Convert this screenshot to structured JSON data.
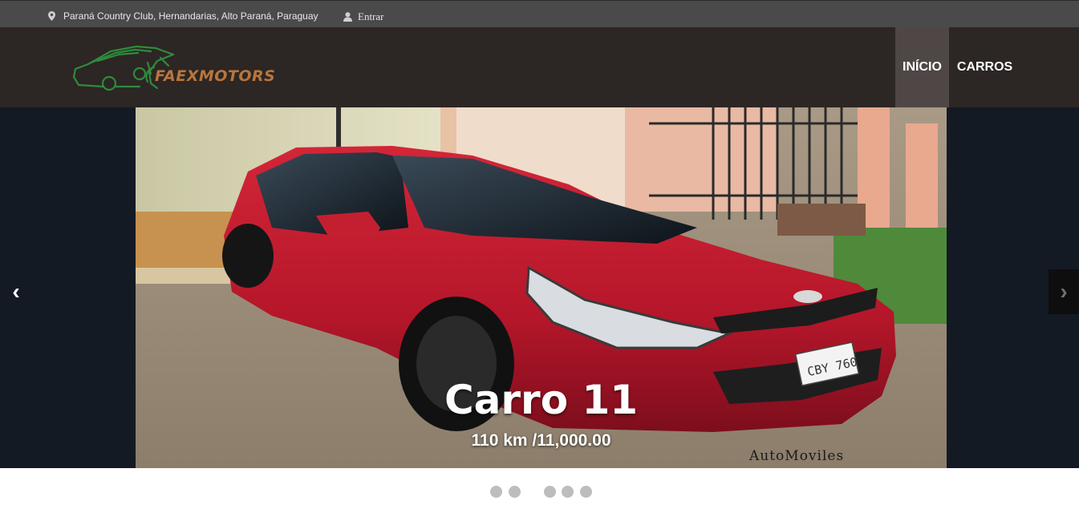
{
  "topbar": {
    "location": "Paraná Country Club, Hernandarias, Alto Paraná, Paraguay",
    "login_label": "Entrar",
    "location_icon": "map-marker-icon",
    "login_icon": "user-icon"
  },
  "brand": {
    "name": "FAEXMOTORS",
    "logo_icon": "car-outline-icon",
    "logo_color": "#2e8b3c",
    "text_color": "#b9763c"
  },
  "nav": {
    "items": [
      {
        "label": "INÍCIO",
        "active": true
      },
      {
        "label": "CARROS",
        "active": false
      }
    ]
  },
  "slider": {
    "title": "Carro 11",
    "subtitle": "110 km /11,000.00",
    "watermark": "AutoMoviles",
    "plate": "CBY 760",
    "prev_symbol": "‹",
    "next_symbol": "›",
    "indicator_count": 5
  },
  "colors": {
    "topbar_bg": "#4a4a4a",
    "navbar_bg": "#2c2624",
    "nav_active_bg": "#4f4745",
    "slider_bg": "#141a24",
    "car_red": "#b5162a",
    "dot": "#bdbdbd"
  }
}
